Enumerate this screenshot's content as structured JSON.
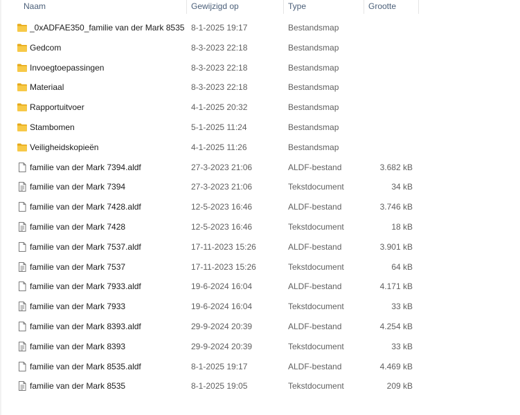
{
  "columns": {
    "name": "Naam",
    "date": "Gewijzigd op",
    "type": "Type",
    "size": "Grootte"
  },
  "colors": {
    "folder": "#f7c948",
    "folder_dark": "#e6a919",
    "header_text": "#4c607a",
    "secondary_text": "#5f5f5f"
  },
  "rows": [
    {
      "icon": "folder-icon",
      "name": "_0xADFAE350_familie van der Mark 8535",
      "date": "8-1-2025 19:17",
      "type": "Bestandsmap",
      "size": ""
    },
    {
      "icon": "folder-icon",
      "name": "Gedcom",
      "date": "8-3-2023 22:18",
      "type": "Bestandsmap",
      "size": ""
    },
    {
      "icon": "folder-icon",
      "name": "Invoegtoepassingen",
      "date": "8-3-2023 22:18",
      "type": "Bestandsmap",
      "size": ""
    },
    {
      "icon": "folder-icon",
      "name": "Materiaal",
      "date": "8-3-2023 22:18",
      "type": "Bestandsmap",
      "size": ""
    },
    {
      "icon": "folder-icon",
      "name": "Rapportuitvoer",
      "date": "4-1-2025 20:32",
      "type": "Bestandsmap",
      "size": ""
    },
    {
      "icon": "folder-icon",
      "name": "Stambomen",
      "date": "5-1-2025 11:24",
      "type": "Bestandsmap",
      "size": ""
    },
    {
      "icon": "folder-icon",
      "name": "Veiligheidskopieën",
      "date": "4-1-2025 11:26",
      "type": "Bestandsmap",
      "size": ""
    },
    {
      "icon": "file-icon",
      "name": "familie van der Mark 7394.aldf",
      "date": "27-3-2023 21:06",
      "type": "ALDF-bestand",
      "size": "3.682 kB"
    },
    {
      "icon": "text-file-icon",
      "name": "familie van der Mark 7394",
      "date": "27-3-2023 21:06",
      "type": "Tekstdocument",
      "size": "34 kB"
    },
    {
      "icon": "file-icon",
      "name": "familie van der Mark 7428.aldf",
      "date": "12-5-2023 16:46",
      "type": "ALDF-bestand",
      "size": "3.746 kB"
    },
    {
      "icon": "text-file-icon",
      "name": "familie van der Mark 7428",
      "date": "12-5-2023 16:46",
      "type": "Tekstdocument",
      "size": "18 kB"
    },
    {
      "icon": "file-icon",
      "name": "familie van der Mark 7537.aldf",
      "date": "17-11-2023 15:26",
      "type": "ALDF-bestand",
      "size": "3.901 kB"
    },
    {
      "icon": "text-file-icon",
      "name": "familie van der Mark 7537",
      "date": "17-11-2023 15:26",
      "type": "Tekstdocument",
      "size": "64 kB"
    },
    {
      "icon": "file-icon",
      "name": "familie van der Mark 7933.aldf",
      "date": "19-6-2024 16:04",
      "type": "ALDF-bestand",
      "size": "4.171 kB"
    },
    {
      "icon": "text-file-icon",
      "name": "familie van der Mark 7933",
      "date": "19-6-2024 16:04",
      "type": "Tekstdocument",
      "size": "33 kB"
    },
    {
      "icon": "file-icon",
      "name": "familie van der Mark 8393.aldf",
      "date": "29-9-2024 20:39",
      "type": "ALDF-bestand",
      "size": "4.254 kB"
    },
    {
      "icon": "text-file-icon",
      "name": "familie van der Mark 8393",
      "date": "29-9-2024 20:39",
      "type": "Tekstdocument",
      "size": "33 kB"
    },
    {
      "icon": "file-icon",
      "name": "familie van der Mark 8535.aldf",
      "date": "8-1-2025 19:17",
      "type": "ALDF-bestand",
      "size": "4.469 kB"
    },
    {
      "icon": "text-file-icon",
      "name": "familie van der Mark 8535",
      "date": "8-1-2025 19:05",
      "type": "Tekstdocument",
      "size": "209 kB"
    }
  ]
}
